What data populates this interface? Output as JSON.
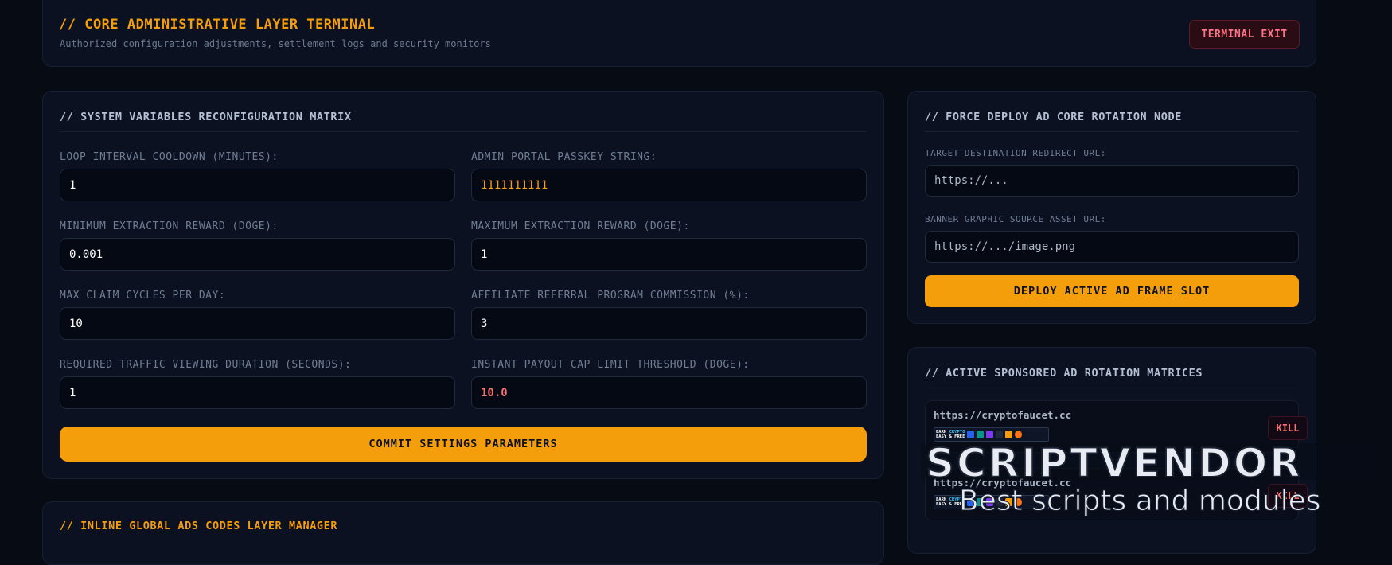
{
  "header": {
    "title": "// CORE ADMINISTRATIVE LAYER TERMINAL",
    "subtitle": "Authorized configuration adjustments, settlement logs and security monitors",
    "exit_label": "TERMINAL EXIT"
  },
  "settings": {
    "title": "// SYSTEM VARIABLES RECONFIGURATION MATRIX",
    "fields": [
      {
        "label": "LOOP INTERVAL COOLDOWN (MINUTES):",
        "value": "1"
      },
      {
        "label": "ADMIN PORTAL PASSKEY STRING:",
        "value": "1111111111"
      },
      {
        "label": "MINIMUM EXTRACTION REWARD (DOGE):",
        "value": "0.001"
      },
      {
        "label": "MAXIMUM EXTRACTION REWARD (DOGE):",
        "value": "1"
      },
      {
        "label": "MAX CLAIM CYCLES PER DAY:",
        "value": "10"
      },
      {
        "label": "AFFILIATE REFERRAL PROGRAM COMMISSION (%):",
        "value": "3"
      },
      {
        "label": "REQUIRED TRAFFIC VIEWING DURATION (SECONDS):",
        "value": "1"
      },
      {
        "label": "INSTANT PAYOUT CAP LIMIT THRESHOLD (DOGE):",
        "value": "10.0"
      }
    ],
    "commit_label": "COMMIT SETTINGS PARAMETERS"
  },
  "deploy": {
    "title": "// FORCE DEPLOY AD CORE ROTATION NODE",
    "redirect_label": "TARGET DESTINATION REDIRECT URL:",
    "redirect_placeholder": "https://...",
    "banner_label": "BANNER GRAPHIC SOURCE ASSET URL:",
    "banner_placeholder": "https://.../image.png",
    "deploy_label": "DEPLOY ACTIVE AD FRAME SLOT"
  },
  "ads": {
    "title": "// ACTIVE SPONSORED AD ROTATION MATRICES",
    "items": [
      {
        "url": "https://cryptofaucet.cc",
        "banner_line1": "EARN",
        "banner_hi": "CRYPTO",
        "banner_line2": "EASY & FREE",
        "kill_label": "KILL"
      },
      {
        "url": "https://cryptofaucet.cc",
        "banner_line1": "EARN",
        "banner_hi": "CRYPTO",
        "banner_line2": "EASY & FREE",
        "kill_label": "KILL"
      }
    ]
  },
  "bottom_panel": {
    "title": "// INLINE GLOBAL ADS CODES LAYER MANAGER"
  },
  "watermark": {
    "title": "SCRIPTVENDOR",
    "subtitle": "Best scripts and modules"
  },
  "colors": {
    "accent": "#f59e0b",
    "danger": "#f87171",
    "background": "#070b14",
    "panel": "#0b1120"
  }
}
